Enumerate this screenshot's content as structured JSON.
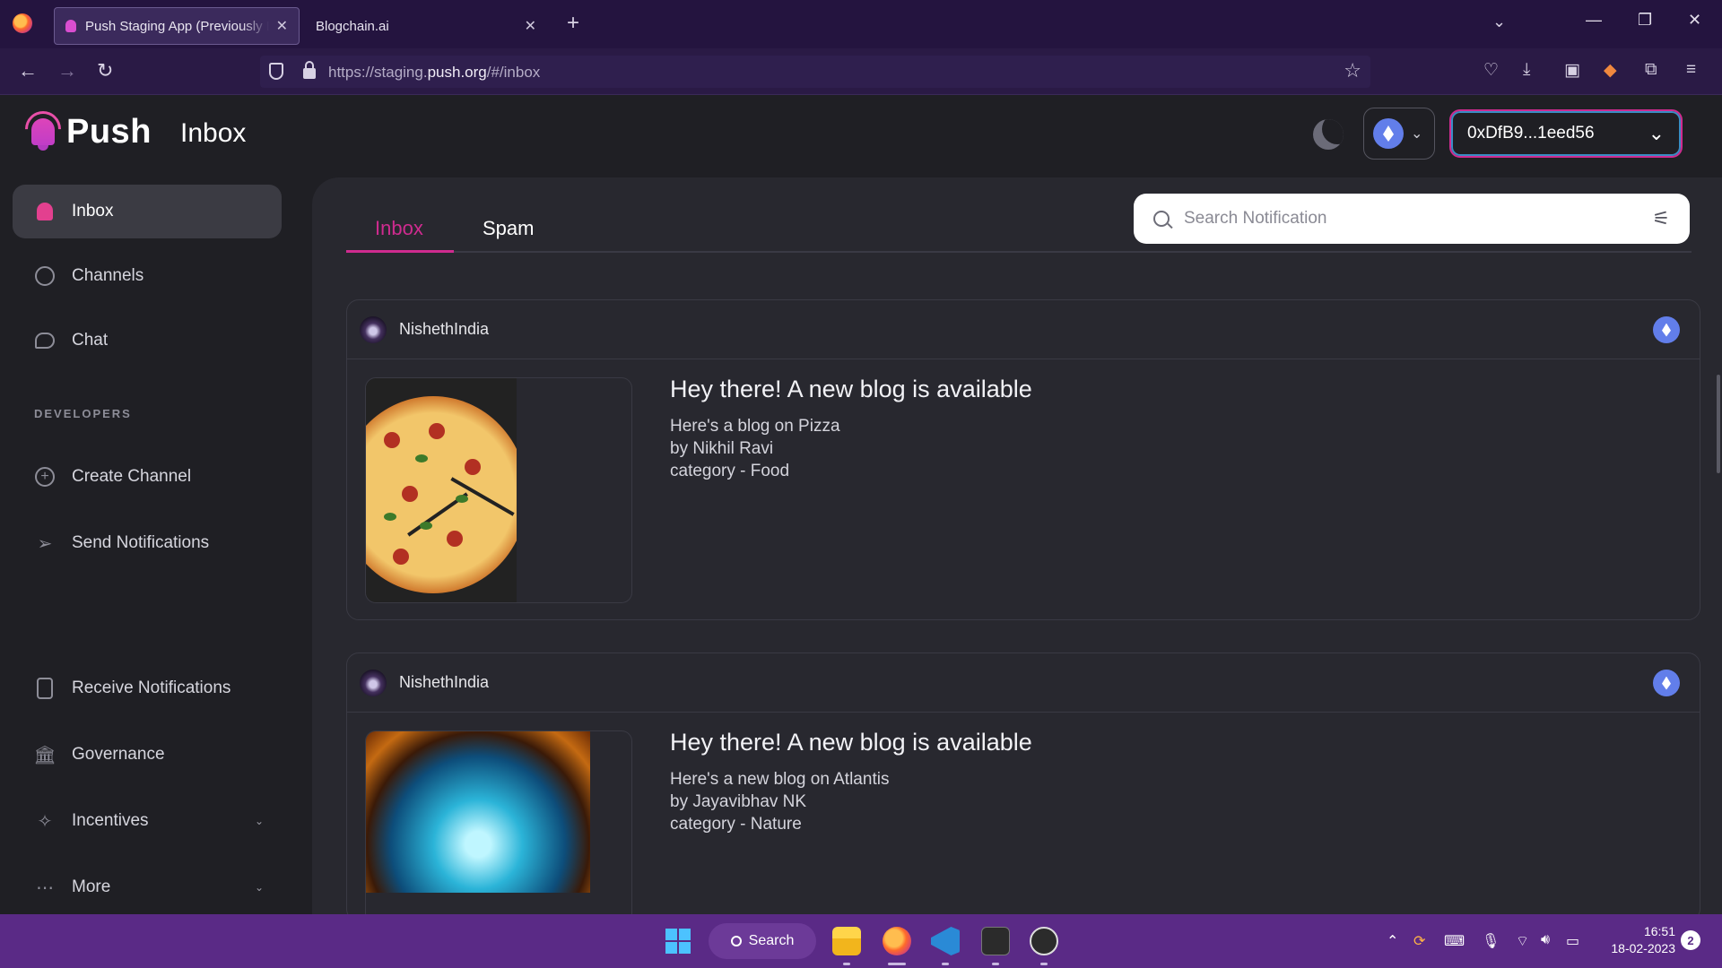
{
  "browser": {
    "tabs": [
      {
        "title": "Push Staging App (Previously EP",
        "active": true
      },
      {
        "title": "Blogchain.ai",
        "active": false
      }
    ],
    "url_prefix": "https://staging.",
    "url_domain": "push.org",
    "url_path": "/#/inbox"
  },
  "app": {
    "logo_text": "Push",
    "page_title": "Inbox",
    "wallet_address": "0xDfB9...1eed56",
    "chain_icon": "ethereum-icon"
  },
  "sidebar": {
    "items": [
      {
        "label": "Inbox",
        "icon": "bell-icon",
        "active": true
      },
      {
        "label": "Channels",
        "icon": "compass-icon"
      },
      {
        "label": "Chat",
        "icon": "chat-bubble-icon"
      }
    ],
    "section_label": "DEVELOPERS",
    "dev_items": [
      {
        "label": "Create Channel",
        "icon": "plus-circle-icon"
      },
      {
        "label": "Send Notifications",
        "icon": "send-icon"
      }
    ],
    "bottom_items": [
      {
        "label": "Receive Notifications",
        "icon": "phone-icon"
      },
      {
        "label": "Governance",
        "icon": "bank-icon"
      },
      {
        "label": "Incentives",
        "icon": "sparkle-icon"
      },
      {
        "label": "More",
        "icon": "dots-icon"
      }
    ]
  },
  "main": {
    "tabs": [
      {
        "label": "Inbox",
        "active": true
      },
      {
        "label": "Spam",
        "active": false
      }
    ],
    "search_placeholder": "Search Notification",
    "notifications": [
      {
        "channel": "NishethIndia",
        "title": "Hey there! A new blog is available",
        "lines": [
          "Here's a blog on Pizza",
          "by Nikhil Ravi",
          "category - Food"
        ],
        "image": "pizza-image"
      },
      {
        "channel": "NishethIndia",
        "title": "Hey there! A new blog is available",
        "lines": [
          "Here's a new blog on Atlantis",
          "by Jayavibhav NK",
          "category - Nature"
        ],
        "image": "atlantis-image"
      }
    ]
  },
  "taskbar": {
    "search_label": "Search",
    "time": "16:51",
    "date": "18-02-2023",
    "notification_count": "2"
  },
  "colors": {
    "accent_pink": "#cf2b8f",
    "eth_blue": "#627eea",
    "browser_purple": "#24143f"
  }
}
